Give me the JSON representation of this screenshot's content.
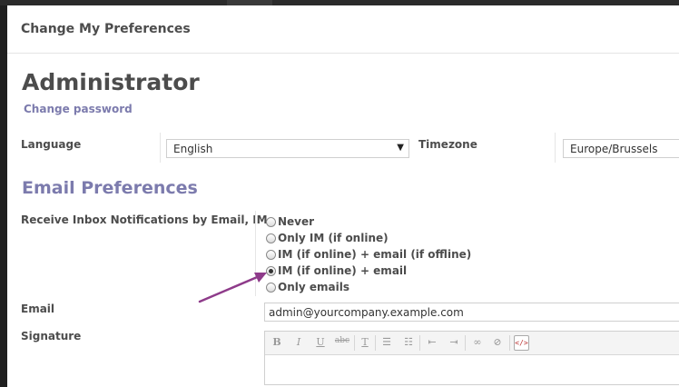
{
  "dialog": {
    "title": "Change My Preferences"
  },
  "user": {
    "name": "Administrator",
    "change_password": "Change password"
  },
  "language": {
    "label": "Language",
    "value": "English"
  },
  "timezone": {
    "label": "Timezone",
    "value": "Europe/Brussels"
  },
  "email_prefs": {
    "section_title": "Email Preferences",
    "notif_label": "Receive Inbox Notifications by Email, IM",
    "options": [
      {
        "label": "Never",
        "selected": false
      },
      {
        "label": "Only IM (if online)",
        "selected": false
      },
      {
        "label": "IM (if online) + email (if offline)",
        "selected": false
      },
      {
        "label": "IM (if online) + email",
        "selected": true
      },
      {
        "label": "Only emails",
        "selected": false
      }
    ]
  },
  "email": {
    "label": "Email",
    "value": "admin@yourcompany.example.com"
  },
  "signature": {
    "label": "Signature",
    "toolbar": [
      "bold-icon",
      "italic-icon",
      "underline-icon",
      "strikethrough-icon",
      "remove-format-icon",
      "bullet-list-icon",
      "numbered-list-icon",
      "outdent-icon",
      "indent-icon",
      "link-icon",
      "unlink-icon",
      "source-icon"
    ]
  },
  "colors": {
    "accent": "#7c7bad",
    "arrow": "#8e3b8a"
  }
}
